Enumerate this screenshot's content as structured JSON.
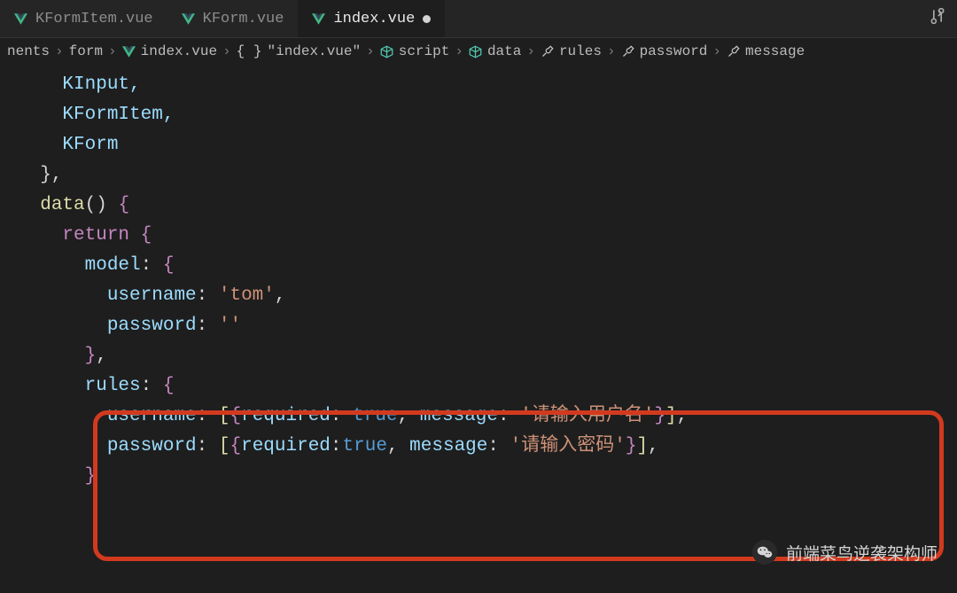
{
  "tabs": [
    {
      "label": "KFormItem.vue",
      "active": false
    },
    {
      "label": "KForm.vue",
      "active": false
    },
    {
      "label": "index.vue",
      "active": true,
      "dirty": true
    }
  ],
  "breadcrumb": {
    "items": [
      {
        "label": "nents",
        "icon": ""
      },
      {
        "label": "form",
        "icon": ""
      },
      {
        "label": "index.vue",
        "icon": "vue"
      },
      {
        "label": "\"index.vue\"",
        "icon": "braces"
      },
      {
        "label": "script",
        "icon": "cube"
      },
      {
        "label": "data",
        "icon": "cube"
      },
      {
        "label": "rules",
        "icon": "wrench"
      },
      {
        "label": "password",
        "icon": "wrench"
      },
      {
        "label": "message",
        "icon": "wrench"
      }
    ]
  },
  "code": {
    "line1": "    KInput,",
    "line2": "    KFormItem,",
    "line3": "    KForm",
    "line4": "  },",
    "data_kw": "data",
    "return_kw": "return",
    "model_kw": "model",
    "username_kw": "username",
    "password_kw": "password",
    "tom_str": "'tom'",
    "empty_str": "''",
    "rules_kw": "rules",
    "required_kw": "required",
    "true_kw": "true",
    "message_kw": "message",
    "msg_user": "'请输入用户名'",
    "msg_pass": "'请输入密码'"
  },
  "watermark": "前端菜鸟逆袭架构师"
}
